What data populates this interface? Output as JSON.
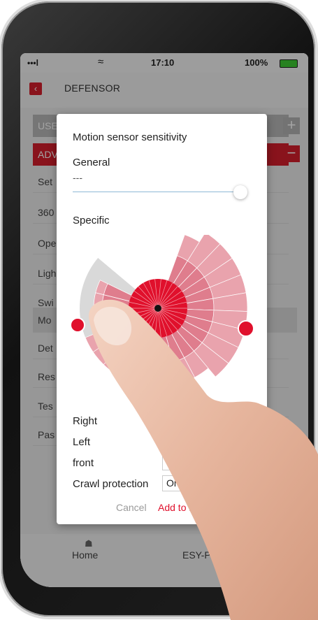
{
  "status_bar": {
    "signal": "•••l",
    "time": "17:10",
    "battery": "100%"
  },
  "header": {
    "back_icon": "chevron-left-icon",
    "title": "DEFENSOR"
  },
  "background": {
    "tab_user": "USE",
    "tab_advanced": "ADV",
    "items": [
      "Set",
      "360",
      "Ope",
      "Ligh",
      "Swi",
      "Mo",
      "Det",
      "Res",
      "Tes",
      "Pas"
    ]
  },
  "tabbar": {
    "home_label": "Home",
    "device_label": "ESY-Pen V"
  },
  "dialog": {
    "title": "Motion sensor sensitivity",
    "general_label": "General",
    "general_value": "---",
    "specific_label": "Specific",
    "rows": [
      {
        "label": "Right",
        "value": ""
      },
      {
        "label": "Left",
        "value": ""
      },
      {
        "label": "front",
        "value": ""
      },
      {
        "label": "Crawl protection",
        "value": "On"
      }
    ],
    "cancel": "Cancel",
    "add": "Add to ba"
  },
  "colors": {
    "accent": "#d71e2c",
    "zone_inner": "#e0102c",
    "zone_outer": "#e9a3ad"
  }
}
